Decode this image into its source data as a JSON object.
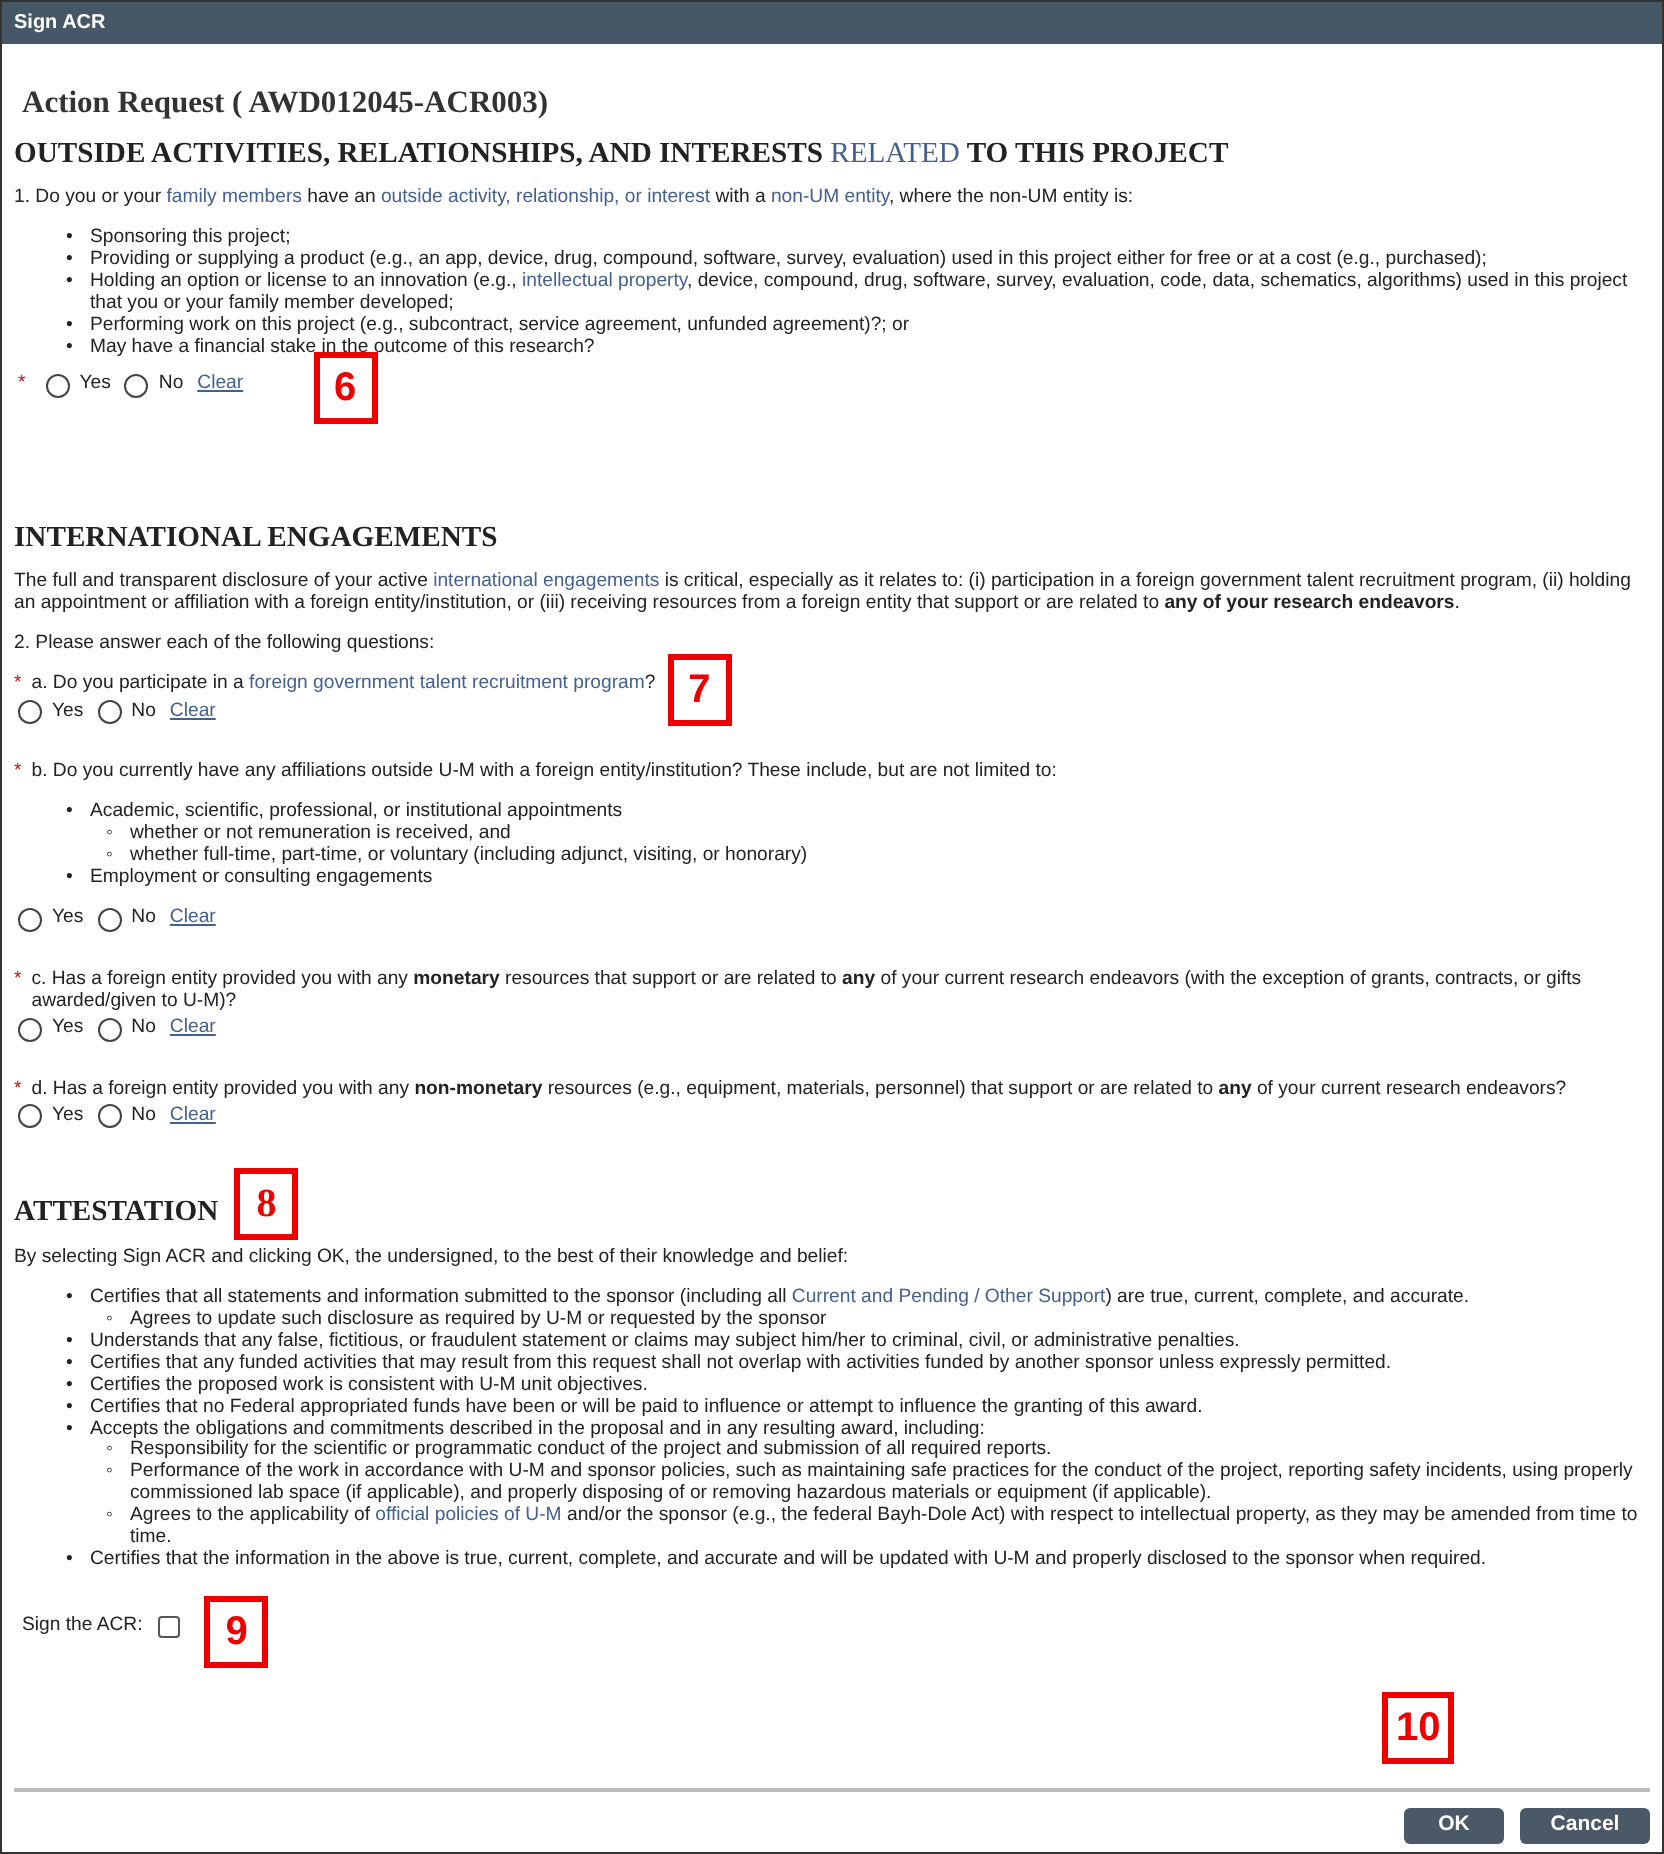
{
  "window": {
    "title": "Sign ACR"
  },
  "request_title": "Action Request (  AWD012045-ACR003)",
  "sections": [
    {
      "heading": [
        {
          "kind": "plain",
          "text": "OUTSIDE ACTIVITIES, RELATIONSHIPS, AND INTERESTS "
        },
        {
          "kind": "link",
          "text": "RELATED"
        },
        {
          "kind": "plain",
          "text": " TO THIS PROJECT"
        }
      ],
      "blocks": [
        {
          "kind": "para",
          "parts": [
            {
              "kind": "plain",
              "text": "1. Do you or your "
            },
            {
              "kind": "link",
              "text": "family members"
            },
            {
              "kind": "plain",
              "text": " have an "
            },
            {
              "kind": "link",
              "text": "outside activity, relationship, or interest"
            },
            {
              "kind": "plain",
              "text": " with a "
            },
            {
              "kind": "link",
              "text": "non-UM entity"
            },
            {
              "kind": "plain",
              "text": ", where the non-UM entity is:"
            }
          ]
        },
        {
          "kind": "list",
          "items": [
            {
              "marker": "•",
              "parts": [
                {
                  "kind": "plain",
                  "text": "Sponsoring this project;"
                }
              ]
            },
            {
              "marker": "•",
              "parts": [
                {
                  "kind": "plain",
                  "text": "Providing or supplying a product (e.g., an app, device, drug, compound, software, survey, evaluation) used in this project either for free or at a cost (e.g., purchased);"
                }
              ]
            },
            {
              "marker": "•",
              "parts": [
                {
                  "kind": "plain",
                  "text": "Holding an option or license to an innovation (e.g., "
                },
                {
                  "kind": "link",
                  "text": "intellectual property"
                },
                {
                  "kind": "plain",
                  "text": ", device, compound, drug, software, survey, evaluation, code, data, schematics, algorithms) used in this project that you or your family member developed;"
                }
              ]
            },
            {
              "marker": "•",
              "parts": [
                {
                  "kind": "plain",
                  "text": "Performing work on this project (e.g., subcontract, service agreement, unfunded agreement)?; or"
                }
              ]
            },
            {
              "marker": "•",
              "parts": [
                {
                  "kind": "plain",
                  "text": "May have a financial stake in the outcome of this research?"
                }
              ]
            }
          ]
        },
        {
          "kind": "answer",
          "required_mark": "*",
          "options": [
            {
              "label": "Yes",
              "selected": false
            },
            {
              "label": "No",
              "selected": false
            }
          ],
          "clear": "Clear",
          "callout": "6"
        }
      ]
    },
    {
      "heading": [
        {
          "kind": "plain",
          "text": "INTERNATIONAL ENGAGEMENTS"
        }
      ],
      "blocks": [
        {
          "kind": "para",
          "parts": [
            {
              "kind": "plain",
              "text": "The full and transparent disclosure of your active "
            },
            {
              "kind": "link",
              "text": "international engagements"
            },
            {
              "kind": "plain",
              "text": " is critical, especially as it relates to: (i) participation in a foreign government talent recruitment program, (ii) holding an appointment or affiliation with a foreign entity/institution, or (iii) receiving resources from a foreign entity that support or are related to "
            },
            {
              "kind": "bold",
              "text": "any of your research endeavors"
            },
            {
              "kind": "plain",
              "text": "."
            }
          ]
        },
        {
          "kind": "para",
          "parts": [
            {
              "kind": "plain",
              "text": "2. Please answer each of the following questions:"
            }
          ]
        },
        {
          "kind": "para",
          "required_mark": "*",
          "callout": "7",
          "parts": [
            {
              "kind": "plain",
              "text": "a. Do you participate in a "
            },
            {
              "kind": "link",
              "text": "foreign government talent recruitment program"
            },
            {
              "kind": "plain",
              "text": "?"
            }
          ]
        },
        {
          "kind": "answer",
          "options": [
            {
              "label": "Yes",
              "selected": false
            },
            {
              "label": "No",
              "selected": false
            }
          ],
          "clear": "Clear"
        },
        {
          "kind": "para",
          "required_mark": "*",
          "parts": [
            {
              "kind": "plain",
              "text": "b. Do you currently have any affiliations outside U-M with a foreign entity/institution? These include, but are not limited to:"
            }
          ]
        },
        {
          "kind": "list",
          "items": [
            {
              "marker": "•",
              "parts": [
                {
                  "kind": "plain",
                  "text": "Academic, scientific, professional, or institutional appointments"
                }
              ],
              "children": [
                {
                  "marker": "◦",
                  "parts": [
                    {
                      "kind": "plain",
                      "text": "whether or not remuneration is received, and"
                    }
                  ]
                },
                {
                  "marker": "◦",
                  "parts": [
                    {
                      "kind": "plain",
                      "text": "whether full-time, part-time, or voluntary (including adjunct, visiting, or honorary)"
                    }
                  ]
                }
              ]
            },
            {
              "marker": "•",
              "parts": [
                {
                  "kind": "plain",
                  "text": "Employment or consulting engagements"
                }
              ]
            }
          ]
        },
        {
          "kind": "answer",
          "options": [
            {
              "label": "Yes",
              "selected": false
            },
            {
              "label": "No",
              "selected": false
            }
          ],
          "clear": "Clear"
        },
        {
          "kind": "para",
          "required_mark": "*",
          "parts": [
            {
              "kind": "plain",
              "text": "c. Has a foreign entity provided you with any "
            },
            {
              "kind": "bold",
              "text": "monetary"
            },
            {
              "kind": "plain",
              "text": " resources that support or are related to "
            },
            {
              "kind": "bold",
              "text": "any"
            },
            {
              "kind": "plain",
              "text": " of your current research endeavors (with the exception of grants, contracts, or gifts awarded/given to U-M)?"
            }
          ]
        },
        {
          "kind": "answer",
          "options": [
            {
              "label": "Yes",
              "selected": false
            },
            {
              "label": "No",
              "selected": false
            }
          ],
          "clear": "Clear"
        },
        {
          "kind": "para",
          "required_mark": "*",
          "parts": [
            {
              "kind": "plain",
              "text": "d. Has a foreign entity provided you with any "
            },
            {
              "kind": "bold",
              "text": "non-monetary"
            },
            {
              "kind": "plain",
              "text": " resources (e.g., equipment, materials, personnel) that support or are related to "
            },
            {
              "kind": "bold",
              "text": "any"
            },
            {
              "kind": "plain",
              "text": " of your current research endeavors?"
            }
          ]
        },
        {
          "kind": "answer",
          "options": [
            {
              "label": "Yes",
              "selected": false
            },
            {
              "label": "No",
              "selected": false
            }
          ],
          "clear": "Clear"
        }
      ]
    },
    {
      "heading": [
        {
          "kind": "plain",
          "text": "ATTESTATION"
        }
      ],
      "callout": "8",
      "blocks": [
        {
          "kind": "para",
          "parts": [
            {
              "kind": "plain",
              "text": "By selecting Sign ACR and clicking OK, the undersigned, to the best of their knowledge and belief:"
            }
          ]
        },
        {
          "kind": "list",
          "items": [
            {
              "marker": "•",
              "parts": [
                {
                  "kind": "plain",
                  "text": "Certifies that all statements and information submitted to the sponsor (including all "
                },
                {
                  "kind": "link",
                  "text": "Current and Pending / Other Support"
                },
                {
                  "kind": "plain",
                  "text": ") are true, current, complete, and accurate."
                }
              ],
              "children": [
                {
                  "marker": "◦",
                  "parts": [
                    {
                      "kind": "plain",
                      "text": "Agrees to update such disclosure as required by U-M or requested by the sponsor"
                    }
                  ]
                }
              ]
            },
            {
              "marker": "•",
              "parts": [
                {
                  "kind": "plain",
                  "text": "Understands that any false, fictitious, or fraudulent statement or claims may subject him/her to criminal, civil, or administrative penalties."
                }
              ]
            },
            {
              "marker": "•",
              "parts": [
                {
                  "kind": "plain",
                  "text": "Certifies that any funded activities that may result from this request shall not overlap with activities funded by another sponsor unless expressly permitted."
                }
              ]
            },
            {
              "marker": "•",
              "parts": [
                {
                  "kind": "plain",
                  "text": "Certifies the proposed work is consistent with U-M unit objectives."
                }
              ]
            },
            {
              "marker": "•",
              "parts": [
                {
                  "kind": "plain",
                  "text": "Certifies that no Federal appropriated funds have been or will be paid to influence or attempt to influence the granting of this award."
                }
              ]
            },
            {
              "marker": "•",
              "parts": [
                {
                  "kind": "plain",
                  "text": "Accepts the obligations and commitments described in the proposal and in any resulting award, including:"
                }
              ],
              "children": [
                {
                  "marker": "◦",
                  "parts": [
                    {
                      "kind": "plain",
                      "text": "Responsibility for the scientific or programmatic conduct of the project and submission of all required reports."
                    }
                  ]
                },
                {
                  "marker": "◦",
                  "parts": [
                    {
                      "kind": "plain",
                      "text": "Performance of the work in accordance with U-M and sponsor policies, such as maintaining safe practices for the conduct of the project, reporting safety incidents, using properly commissioned lab space (if applicable), and properly disposing of or removing hazardous materials or equipment (if applicable)."
                    }
                  ]
                },
                {
                  "marker": "◦",
                  "parts": [
                    {
                      "kind": "plain",
                      "text": "Agrees to the applicability of "
                    },
                    {
                      "kind": "link",
                      "text": "official policies of U-M"
                    },
                    {
                      "kind": "plain",
                      "text": " and/or the sponsor (e.g., the federal Bayh-Dole Act) with respect to intellectual property, as they may be amended from time to time."
                    }
                  ]
                }
              ]
            },
            {
              "marker": "•",
              "parts": [
                {
                  "kind": "plain",
                  "text": "Certifies that the information in the above is true, current, complete, and accurate and will be updated with U-M and properly disclosed to the sponsor when required."
                }
              ]
            }
          ]
        },
        {
          "kind": "checkbox",
          "label": "Sign the ACR:",
          "checked": false,
          "callout": "9"
        }
      ]
    }
  ],
  "footer": {
    "callout": "10",
    "buttons": [
      {
        "label": "OK"
      },
      {
        "label": "Cancel"
      }
    ]
  }
}
